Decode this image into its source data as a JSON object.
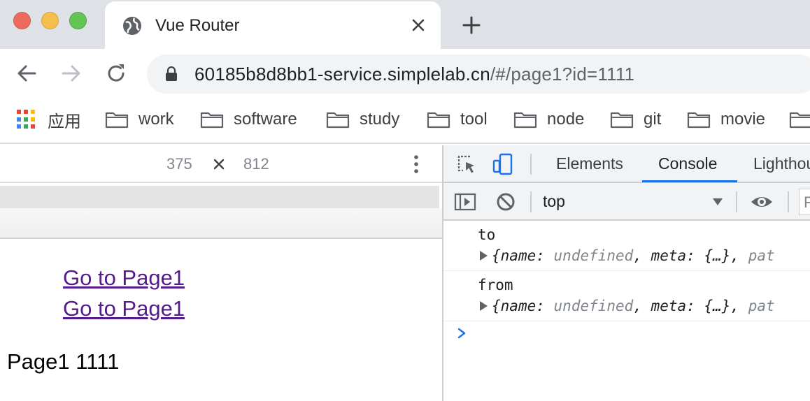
{
  "window": {
    "tab": {
      "title": "Vue Router"
    }
  },
  "toolbar": {
    "url_host": "60185b8d8bb1-service.simplelab.cn",
    "url_path": "/#/page1?id=1111"
  },
  "bookmarks": {
    "apps_label": "应用",
    "folders": [
      "work",
      "software",
      "study",
      "tool",
      "node",
      "git",
      "movie"
    ]
  },
  "device_toolbar": {
    "width": "375",
    "times": "×",
    "height": "812"
  },
  "page": {
    "links": [
      "Go to Page1",
      "Go to Page1"
    ],
    "content": "Page1 1111"
  },
  "devtools": {
    "tabs": [
      "Elements",
      "Console",
      "Lighthouse"
    ],
    "active_tab": "Console",
    "context": "top",
    "filter_placeholder": "Filter",
    "messages": [
      {
        "label": "to",
        "object": {
          "name_key": "name",
          "name_value": "undefined",
          "meta_key": "meta",
          "meta_value": "{…}",
          "rest": "pat"
        }
      },
      {
        "label": "from",
        "object": {
          "name_key": "name",
          "name_value": "undefined",
          "meta_key": "meta",
          "meta_value": "{…}",
          "rest": "pat"
        }
      }
    ]
  },
  "colors": {
    "accent": "#1a73e8",
    "link_visited": "#551a8b",
    "traffic_red": "#ed6a5e",
    "traffic_yellow": "#f5bf4f",
    "traffic_green": "#62c554"
  }
}
